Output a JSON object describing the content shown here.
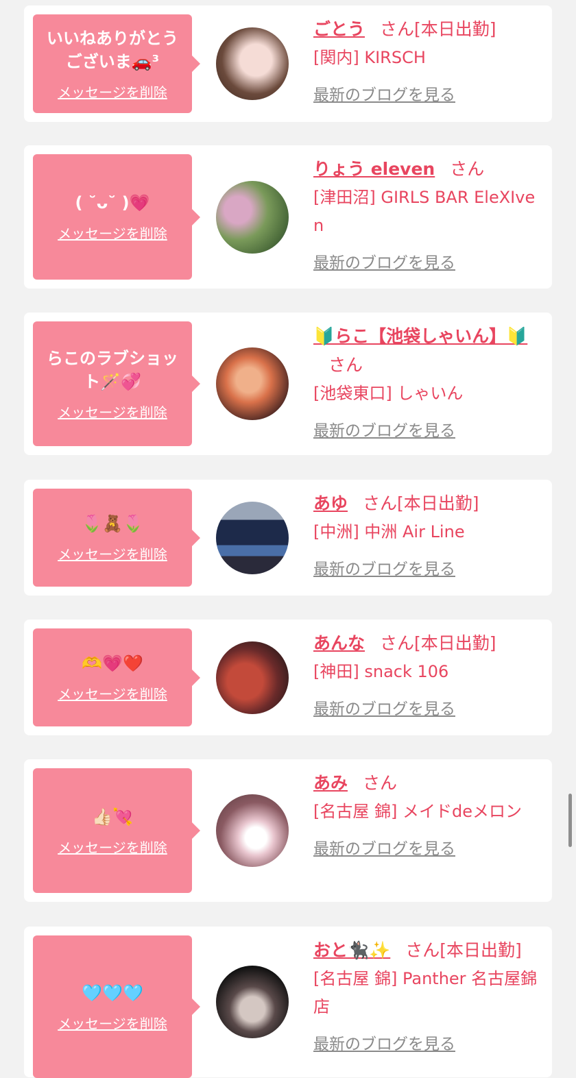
{
  "cards": [
    {
      "message": "いいねありがとうございま🚗³",
      "delete_label": "メッセージを削除",
      "name": "ごとう",
      "san": "さん",
      "status": "[本日出勤]",
      "shop": "[関内] KIRSCH",
      "blog_link": "最新のブログを見る",
      "avatar_colors": [
        "#6b4a3c",
        "#e6c9c1"
      ]
    },
    {
      "message": "( ˘ᴗ˘ )💗",
      "delete_label": "メッセージを削除",
      "name": "りょう eleven",
      "san": "さん",
      "status": "",
      "shop": "[津田沼] GIRLS BAR EleXIven",
      "blog_link": "最新のブログを見る",
      "avatar_colors": [
        "#5b7a4a",
        "#d9a7c4"
      ]
    },
    {
      "message": "らこのラブショット🪄💞",
      "delete_label": "メッセージを削除",
      "name": "🔰らこ【池袋しゃいん】🔰",
      "san": "さん",
      "status": "",
      "shop": "[池袋東口] しゃいん",
      "blog_link": "最新のブログを見る",
      "avatar_colors": [
        "#3a1e1e",
        "#d9714a"
      ]
    },
    {
      "message": "🌷🧸🌷",
      "delete_label": "メッセージを削除",
      "name": "あゆ",
      "san": "さん",
      "status": "[本日出勤]",
      "shop": "[中洲] 中洲 Air Line",
      "blog_link": "最新のブログを見る",
      "avatar_colors": [
        "#1d2a4a",
        "#4a6fa8"
      ]
    },
    {
      "message": "🫶💗❤️",
      "delete_label": "メッセージを削除",
      "name": "あんな",
      "san": "さん",
      "status": "[本日出勤]",
      "shop": "[神田] snack 106",
      "blog_link": "最新のブログを見る",
      "avatar_colors": [
        "#2a1a1a",
        "#c34a3a"
      ]
    },
    {
      "message": "👍🏻💘",
      "delete_label": "メッセージを削除",
      "name": "あみ",
      "san": "さん",
      "status": "",
      "shop": "[名古屋 錦] メイドdeメロン",
      "blog_link": "最新のブログを見る",
      "avatar_colors": [
        "#5a3a3e",
        "#e9c6cf"
      ]
    },
    {
      "message": "🩵🩵🩵",
      "delete_label": "メッセージを削除",
      "name": "おと🐈‍⬛✨",
      "san": "さん",
      "status": "[本日出勤]",
      "shop": "[名古屋 錦] Panther 名古屋錦店",
      "blog_link": "最新のブログを見る",
      "avatar_colors": [
        "#111111",
        "#d4c7c2"
      ]
    }
  ]
}
